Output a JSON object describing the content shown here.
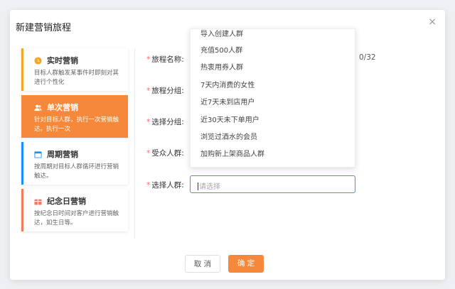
{
  "dialog": {
    "title": "新建营销旅程",
    "close_glyph": "×"
  },
  "types": [
    {
      "name": "实时营销",
      "desc": "目标人群触发某事件时即刻对其进行个性化",
      "accent": "#f5a623",
      "icon": "clock-icon"
    },
    {
      "name": "单次营销",
      "desc": "针对目标人群，执行一次营销触达。执行一次",
      "accent": "#f5883a",
      "icon": "users-icon"
    },
    {
      "name": "周期营销",
      "desc": "按周期对目标人群循环进行营销触达。",
      "accent": "#1890ff",
      "icon": "calendar-icon"
    },
    {
      "name": "纪念日营销",
      "desc": "按纪念日时间对客户进行营销触达，如生日等。",
      "accent": "#f07b5b",
      "icon": "gift-icon"
    }
  ],
  "form": {
    "required_mark": "*",
    "journey_name_label": "旅程名称:",
    "journey_name_counter": "0/32",
    "journey_group_label": "旅程分组:",
    "select_group_label": "选择分组:",
    "audience_label": "受众人群:",
    "select_crowd_label": "选择人群:",
    "select_crowd_placeholder": "请选择"
  },
  "dropdown_options": [
    "导入创建人群",
    "充值500人群",
    "热衷用券人群",
    "7天内消费的女性",
    "近7天未到店用户",
    "近30天未下单用户",
    "浏览过酒水的会员",
    "加购新上架商品人群"
  ],
  "buttons": {
    "cancel": "取 消",
    "confirm": "确 定"
  },
  "colors": {
    "accent": "#f5883a",
    "focus_border": "#4a90e2",
    "required": "#f56c6c"
  }
}
